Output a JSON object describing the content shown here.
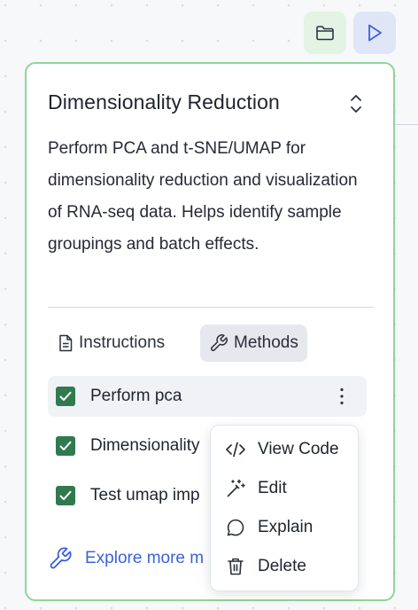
{
  "toolbar": {
    "folder_icon": "folder-icon",
    "run_icon": "play-icon"
  },
  "card": {
    "title": "Dimensionality Reduction",
    "description": "Perform PCA and t-SNE/UMAP for dimensionality reduction and visualization of RNA-seq data. Helps identify sample groupings and batch effects.",
    "border_color": "#8fd49a",
    "tabs": [
      {
        "label": "Instructions",
        "icon": "document-icon",
        "active": false
      },
      {
        "label": "Methods",
        "icon": "wrench-icon",
        "active": true
      }
    ],
    "methods": [
      {
        "label": "Perform pca",
        "checked": true
      },
      {
        "label": "Dimensionality",
        "checked": true
      },
      {
        "label": "Test umap imp",
        "checked": true
      }
    ],
    "explore_link": "Explore more m"
  },
  "context_menu": {
    "items": [
      {
        "label": "View Code",
        "icon": "code-icon"
      },
      {
        "label": "Edit",
        "icon": "magic-wand-icon"
      },
      {
        "label": "Explain",
        "icon": "chat-bubble-icon"
      },
      {
        "label": "Delete",
        "icon": "trash-icon"
      }
    ]
  },
  "colors": {
    "accent_blue": "#3c63d6",
    "checkbox_green": "#2f7a4f"
  }
}
